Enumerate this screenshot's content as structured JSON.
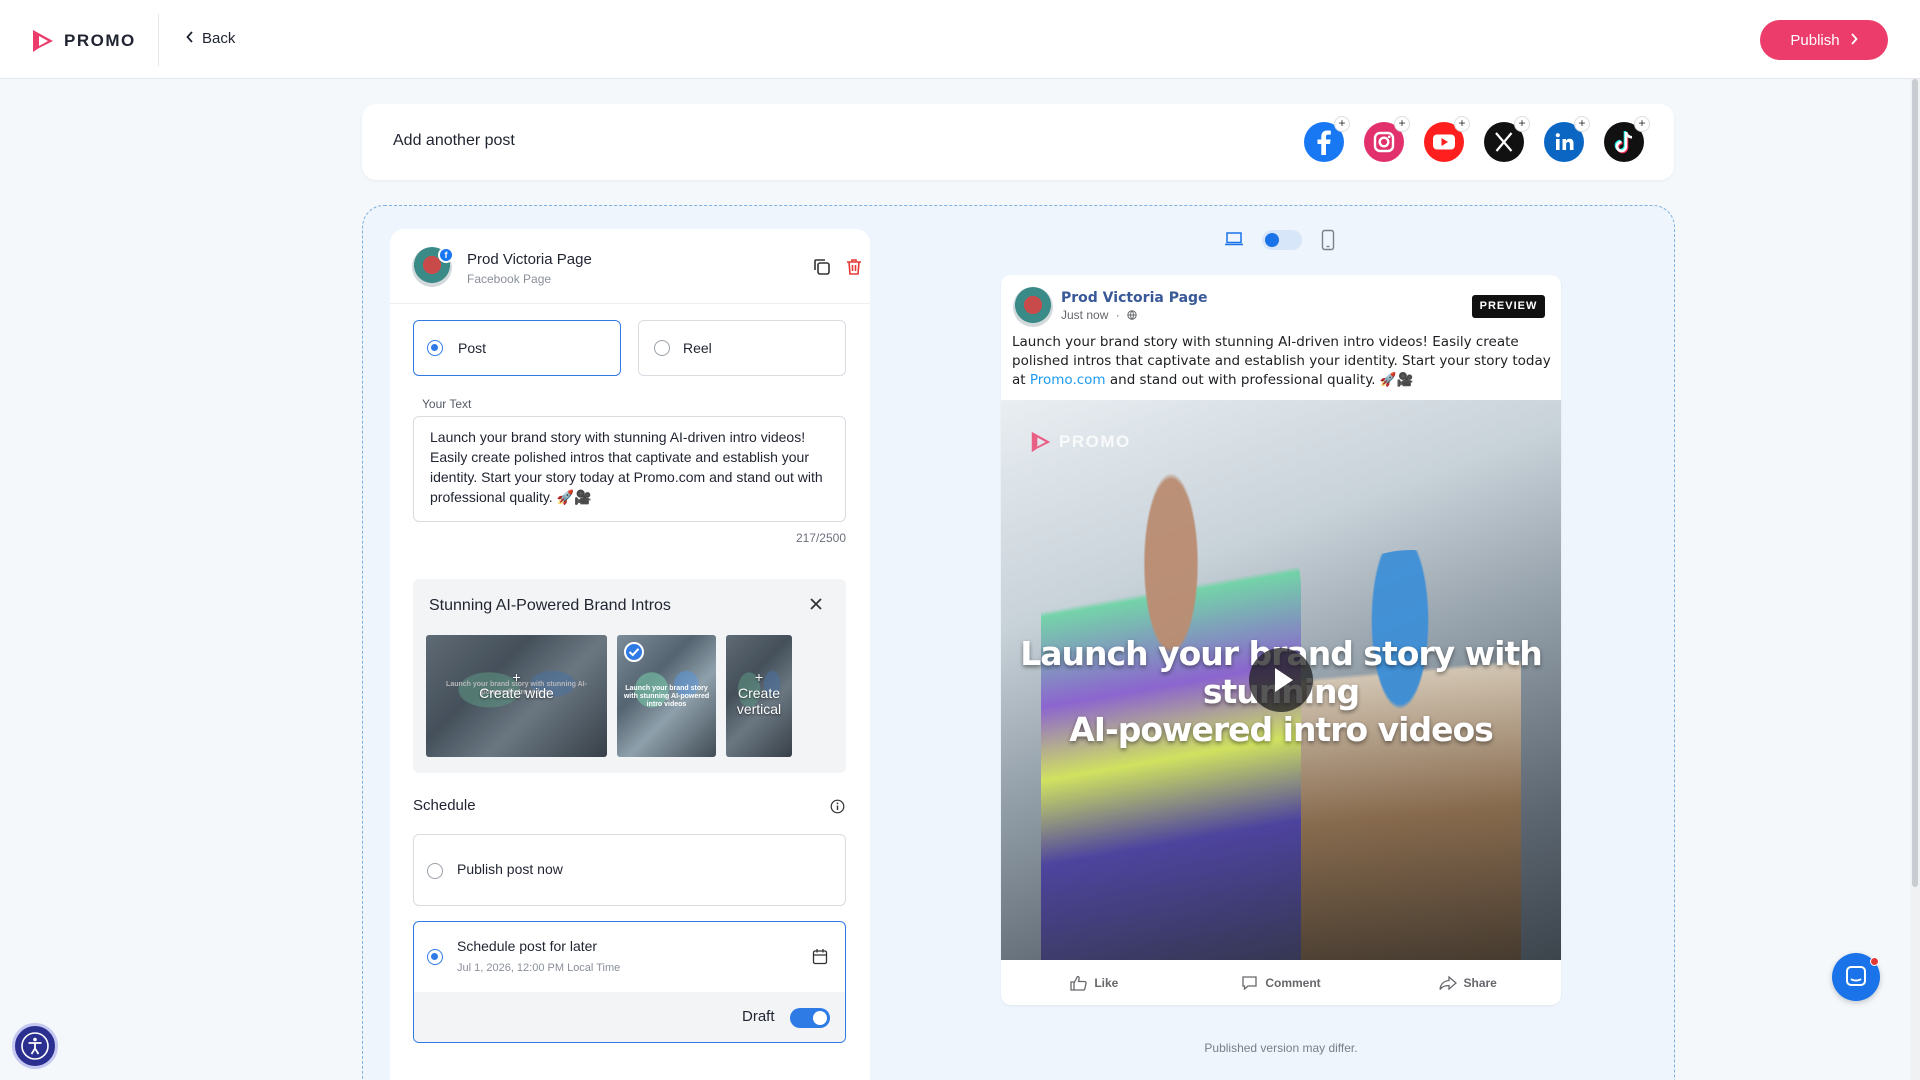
{
  "brand": {
    "logo_text": "PROMO",
    "accent": "#ec3c6b"
  },
  "nav": {
    "back_label": "Back",
    "publish_label": "Publish"
  },
  "add_post": {
    "label": "Add another post",
    "platforms": [
      "facebook-icon",
      "instagram-icon",
      "youtube-icon",
      "x-icon",
      "linkedin-icon",
      "tiktok-icon"
    ]
  },
  "account": {
    "name": "Prod Victoria Page",
    "type": "Facebook Page",
    "badge_icon": "facebook-icon"
  },
  "post_type": {
    "options": [
      {
        "label": "Post",
        "selected": true
      },
      {
        "label": "Reel",
        "selected": false
      }
    ]
  },
  "text": {
    "label": "Your Text",
    "value": "Launch your brand story with stunning AI-driven intro videos! Easily create polished intros that captivate and establish your identity. Start your story today at Promo.com and stand out with professional quality. 🚀🎥",
    "counter": "217/2500"
  },
  "media": {
    "title": "Stunning AI-Powered Brand Intros",
    "thumbs": [
      {
        "label": "Create wide",
        "plus": "+",
        "caption": "Launch your brand story with stunning AI-powered intro videos"
      },
      {
        "label": "",
        "caption": "Launch your brand story with stunning AI-powered intro videos",
        "selected": true
      },
      {
        "label": "Create vertical",
        "plus": "+",
        "caption": ""
      }
    ]
  },
  "schedule": {
    "label": "Schedule",
    "now_label": "Publish post now",
    "later_label": "Schedule post for later",
    "later_datetime": "Jul 1, 2026, 12:00 PM Local Time",
    "draft_label": "Draft",
    "draft_on": true,
    "selected": "later"
  },
  "preview": {
    "name": "Prod Victoria Page",
    "time": "Just now",
    "separator": "·",
    "badge": "PREVIEW",
    "text_before": "Launch your brand story with stunning AI-driven intro videos! Easily create polished intros that captivate and establish your identity. Start your story today at ",
    "link": "Promo.com",
    "text_after": " and stand out with professional quality. 🚀🎥",
    "media_logo": "PROMO",
    "media_caption_line1": "Launch your brand story with stunning",
    "media_caption_line2": "AI-powered intro videos",
    "actions": {
      "like": "Like",
      "comment": "Comment",
      "share": "Share"
    },
    "disclaimer": "Published version may differ."
  }
}
